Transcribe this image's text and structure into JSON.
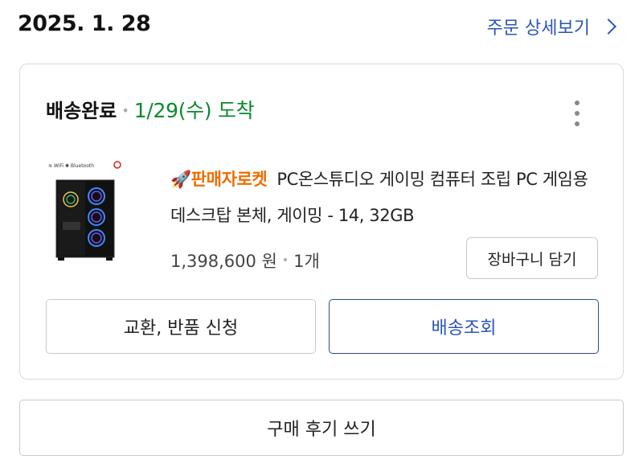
{
  "order": {
    "date": "2025. 1. 28",
    "detail_link_label": "주문 상세보기"
  },
  "delivery": {
    "status": "배송완료",
    "arrival": "1/29(수) 도착"
  },
  "product": {
    "badge": "판매자로켓",
    "badge_icon": "rocket-icon",
    "title": "PC온스튜디오 게이밍 컴퓨터 조립 PC 게임용 데스크탑 본체, 게이밍 - 14, 32GB",
    "price": "1,398,600 원",
    "quantity": "1개",
    "thumbnail_icon": "gaming-pc-case-image"
  },
  "actions": {
    "add_to_cart": "장바구니 담기",
    "exchange_return": "교환, 반품 신청",
    "track_delivery": "배송조회",
    "write_review": "구매 후기 쓰기"
  },
  "colors": {
    "link_blue": "#2a55b8",
    "delivered_green": "#0a8a2e",
    "badge_orange": "#ee6d00"
  }
}
